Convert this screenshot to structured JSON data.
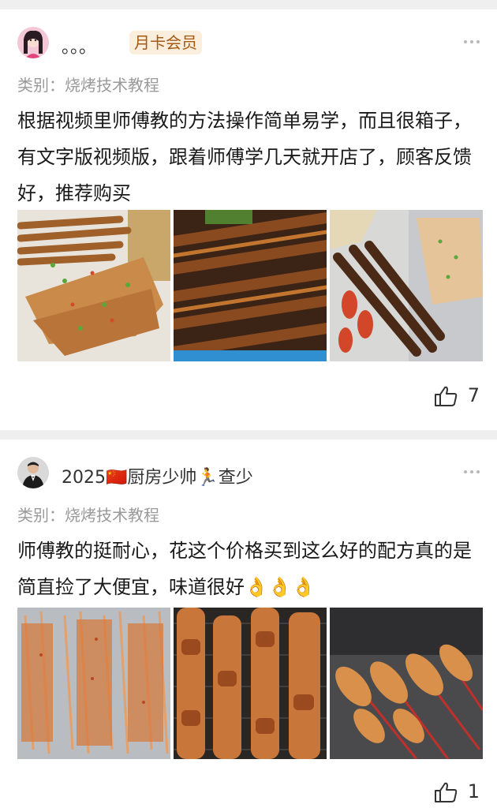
{
  "posts": [
    {
      "username": "。。。",
      "badge": "月卡会员",
      "category_label": "类别：",
      "category_value": "烧烤技术教程",
      "content": "根据视频里师傅教的方法操作简单易学，而且很箱子，有文字版视频版，跟着师傅学几天就开店了，顾客反馈好，推荐购买",
      "likes": "7"
    },
    {
      "username": "2025🇨🇳厨房少帅🏃查少",
      "category_label": "类别：",
      "category_value": "烧烤技术教程",
      "content": "师傅教的挺耐心，花这个价格买到这么好的配方真的是简直捡了大便宜，味道很好👌👌👌",
      "likes": "1"
    }
  ],
  "icons": {
    "more": "more-dots-icon",
    "like": "thumbs-up-icon"
  }
}
